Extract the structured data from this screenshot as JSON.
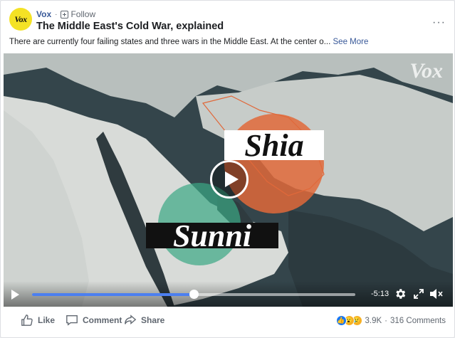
{
  "post": {
    "page_name": "Vox",
    "avatar_text": "Vox",
    "separator": "·",
    "follow_label": "Follow",
    "title": "The Middle East's Cold War, explained",
    "more_label": "···",
    "description": "There are currently four failing states and three wars in the Middle East. At the center o...",
    "see_more_label": "See More"
  },
  "video": {
    "watermark": "Vox",
    "overlay_word_shia": "Shia",
    "overlay_word_sunni": "Sunni",
    "time_remaining": "-5:13",
    "progress": 0.5
  },
  "actions": {
    "like_label": "Like",
    "comment_label": "Comment",
    "share_label": "Share"
  },
  "reactions": {
    "count": "3.9K",
    "separator": "·",
    "comments": "316 Comments"
  },
  "colors": {
    "link": "#385898",
    "progress": "#4c7ff0",
    "shia_circle": "#e0683a",
    "sunni_circle": "#3aa884"
  },
  "icons": [
    "follow-icon",
    "more-icon",
    "play-icon",
    "gear-icon",
    "expand-icon",
    "mute-icon",
    "like-icon",
    "comment-icon",
    "share-icon"
  ]
}
